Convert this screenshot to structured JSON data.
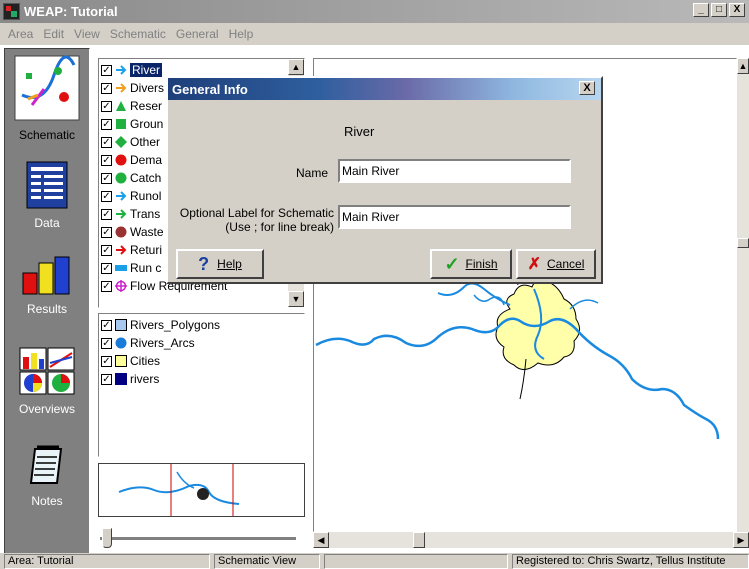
{
  "window": {
    "title": "WEAP: Tutorial",
    "minimize": "_",
    "restore": "□",
    "close": "X"
  },
  "menu": [
    "Area",
    "Edit",
    "View",
    "Schematic",
    "General",
    "Help"
  ],
  "nav": {
    "schematic": "Schematic",
    "data": "Data",
    "results": "Results",
    "overviews": "Overviews",
    "notes": "Notes"
  },
  "tree": [
    {
      "label": "River",
      "icon": "river-arrow-icon",
      "color": "#1aa0e8"
    },
    {
      "label": "Divers",
      "icon": "diversion-arrow-icon",
      "color": "#f0a020"
    },
    {
      "label": "Reser",
      "icon": "reservoir-triangle-icon",
      "color": "#20b040"
    },
    {
      "label": "Groun",
      "icon": "groundwater-square-icon",
      "color": "#20b040"
    },
    {
      "label": "Other",
      "icon": "other-supply-diamond-icon",
      "color": "#20b040"
    },
    {
      "label": "Dema",
      "icon": "demand-circle-icon",
      "color": "#e01010"
    },
    {
      "label": "Catch",
      "icon": "catchment-circle-icon",
      "color": "#20b040"
    },
    {
      "label": "Runol",
      "icon": "runoff-arrow-icon",
      "color": "#1aa0e8"
    },
    {
      "label": "Trans",
      "icon": "transmission-arrow-icon",
      "color": "#20b040"
    },
    {
      "label": "Waste",
      "icon": "wastewater-circle-icon",
      "color": "#993333"
    },
    {
      "label": "Returi",
      "icon": "return-flow-arrow-icon",
      "color": "#e01010"
    },
    {
      "label": "Run c",
      "icon": "run-of-river-icon",
      "color": "#1aa0e8"
    },
    {
      "label": "Flow Requirement",
      "icon": "flow-requirement-icon",
      "color": "#cc22cc"
    }
  ],
  "layers": [
    {
      "label": "Rivers_Polygons",
      "swatch": "#a8c8f0"
    },
    {
      "label": "Rivers_Arcs",
      "swatch": "#1a7ad8"
    },
    {
      "label": "Cities",
      "swatch": "#ffff99"
    },
    {
      "label": "rivers",
      "swatch": "#000080"
    }
  ],
  "dialog": {
    "title": "General Info",
    "close": "X",
    "type": "River",
    "name_label": "Name",
    "name_value": "Main River",
    "label_label_1": "Optional Label for Schematic",
    "label_label_2": "(Use ; for line break)",
    "label_value": "Main River",
    "help": "Help",
    "finish": "Finish",
    "cancel": "Cancel"
  },
  "status": {
    "area": "Area: Tutorial",
    "view": "Schematic View",
    "registered": "Registered to: Chris Swartz, Tellus Institute"
  },
  "colors": {
    "river": "#1a8ae0",
    "city": "#ffffaa",
    "nav_bg": "#808080"
  }
}
